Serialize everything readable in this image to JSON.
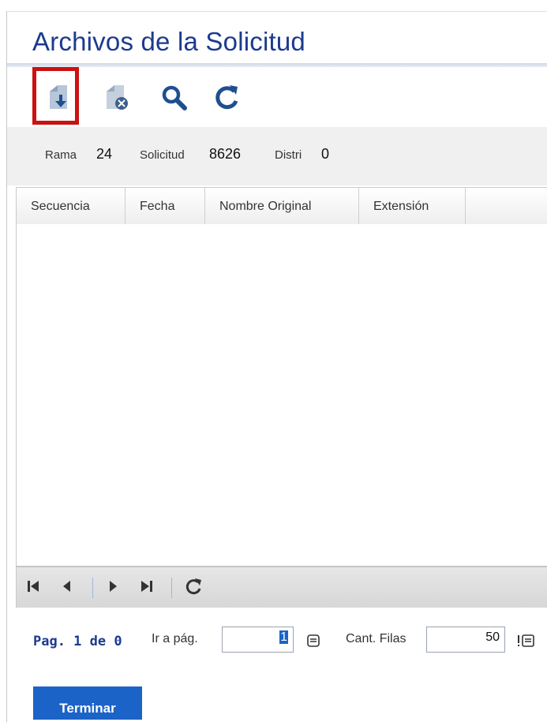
{
  "window": {
    "title": "Archivos de la Solicitud"
  },
  "toolbar": {
    "buttons": [
      {
        "icon": "file-download-icon",
        "highlighted": true
      },
      {
        "icon": "file-delete-icon"
      },
      {
        "icon": "search-icon"
      },
      {
        "icon": "refresh-icon"
      }
    ],
    "highlight_color": "#cc1111"
  },
  "info": {
    "rama_label": "Rama",
    "rama_value": "24",
    "solicitud_label": "Solicitud",
    "solicitud_value": "8626",
    "distri_label": "Distri",
    "distri_value": "0"
  },
  "grid": {
    "columns": [
      "Secuencia",
      "Fecha",
      "Nombre Original",
      "Extensión"
    ],
    "rows": []
  },
  "pager": {
    "icons": [
      "first-page-icon",
      "prev-page-icon",
      "next-page-icon",
      "last-page-icon",
      "refresh-icon"
    ]
  },
  "footer": {
    "page_text": "Pag. 1 de 0",
    "goto_label": "Ir a pág.",
    "goto_value": "1",
    "rows_label": "Cant. Filas",
    "rows_value": "50",
    "finish_label": "Terminar"
  },
  "colors": {
    "accent": "#1c3a8f",
    "button": "#1c63c7"
  }
}
